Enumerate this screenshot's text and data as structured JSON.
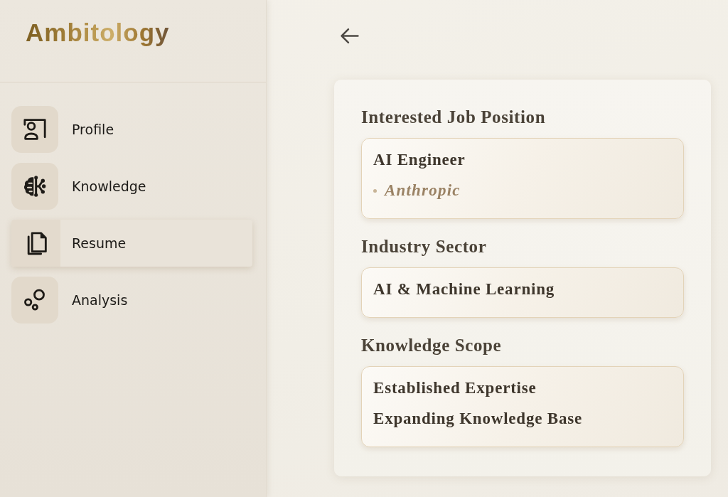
{
  "sidebar": {
    "logo": "Ambitology",
    "items": [
      {
        "label": "Profile",
        "kind": "profile",
        "selected": false
      },
      {
        "label": "Knowledge",
        "kind": "knowledge",
        "selected": false
      },
      {
        "label": "Resume",
        "kind": "resume",
        "selected": true
      },
      {
        "label": "Analysis",
        "kind": "analysis",
        "selected": false
      }
    ]
  },
  "details": {
    "sections": [
      {
        "label": "Interested Job Position",
        "lines": [
          {
            "kind": "plain",
            "text": "AI Engineer"
          },
          {
            "kind": "company",
            "text": "Anthropic"
          }
        ]
      },
      {
        "label": "Industry Sector",
        "lines": [
          {
            "kind": "plain",
            "text": "AI & Machine Learning"
          }
        ]
      },
      {
        "label": "Knowledge Scope",
        "lines": [
          {
            "kind": "plain",
            "text": "Established Expertise"
          },
          {
            "kind": "plain",
            "text": "Expanding Knowledge Base"
          }
        ]
      }
    ]
  }
}
